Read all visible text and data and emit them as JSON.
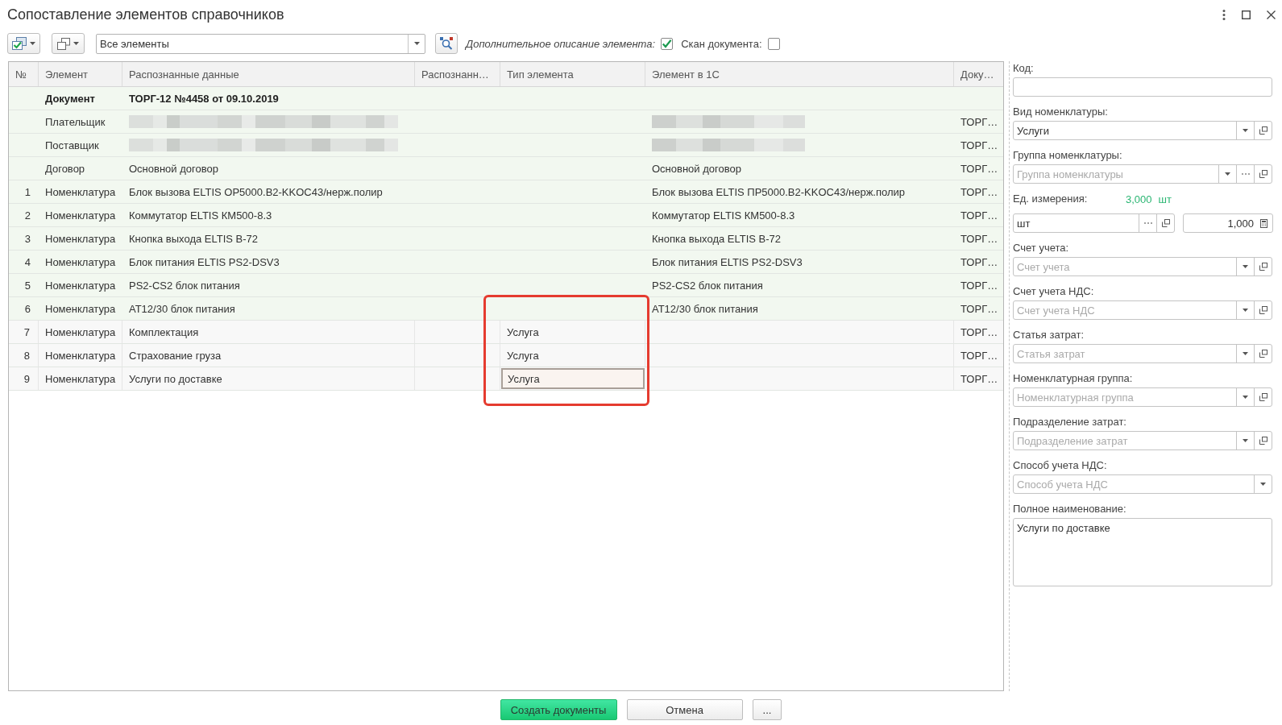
{
  "window": {
    "title": "Сопоставление элементов справочников"
  },
  "toolbar": {
    "filter": {
      "value": "Все элементы"
    },
    "options": [
      {
        "label": "Дополнительное описание элемента:",
        "italic": true,
        "checked": true
      },
      {
        "label": "Скан документа:",
        "italic": false,
        "checked": false
      }
    ]
  },
  "table": {
    "columns": [
      "№",
      "Элемент",
      "Распознанные данные",
      "Распознанн…",
      "Тип элемента",
      "Элемент в 1С",
      "Доку…"
    ],
    "rows": [
      {
        "kind": "document",
        "element": "Документ",
        "recognized": "ТОРГ-12 №4458 от 09.10.2019",
        "redacted": false,
        "matched": true,
        "selected": false
      },
      {
        "kind": "entry",
        "element": "Плательщик",
        "redacted": true,
        "doc": "ТОРГ…",
        "matched": true,
        "selected": false
      },
      {
        "kind": "entry",
        "element": "Поставщик",
        "redacted": true,
        "doc": "ТОРГ…",
        "matched": true,
        "selected": false
      },
      {
        "kind": "entry",
        "element": "Договор",
        "recognized": "Основной договор",
        "element_1c": "Основной договор",
        "doc": "ТОРГ…",
        "redacted": false,
        "matched": true,
        "selected": false
      },
      {
        "kind": "entry",
        "number": "1",
        "element": "Номенклатура",
        "recognized": "Блок вызова ELTIS OP5000.B2-KKOC43/нерж.полир",
        "element_1c": "Блок вызова ELTIS ПР5000.B2-KKOC43/нерж.полир",
        "doc": "ТОРГ…",
        "redacted": false,
        "matched": true,
        "selected": false
      },
      {
        "kind": "entry",
        "number": "2",
        "element": "Номенклатура",
        "recognized": "Коммутатор ELTIS КМ500-8.3",
        "element_1c": "Коммутатор ELTIS КМ500-8.3",
        "doc": "ТОРГ…",
        "redacted": false,
        "matched": true,
        "selected": false
      },
      {
        "kind": "entry",
        "number": "3",
        "element": "Номенклатура",
        "recognized": "Кнопка выхода ELTIS B-72",
        "element_1c": "Кнопка выхода ELTIS B-72",
        "doc": "ТОРГ…",
        "redacted": false,
        "matched": true,
        "selected": false
      },
      {
        "kind": "entry",
        "number": "4",
        "element": "Номенклатура",
        "recognized": "Блок питания ELTIS PS2-DSV3",
        "element_1c": "Блок питания ELTIS PS2-DSV3",
        "doc": "ТОРГ…",
        "redacted": false,
        "matched": true,
        "selected": false
      },
      {
        "kind": "entry",
        "number": "5",
        "element": "Номенклатура",
        "recognized": "PS2-CS2 блок питания",
        "element_1c": "PS2-CS2 блок питания",
        "doc": "ТОРГ…",
        "redacted": false,
        "matched": true,
        "selected": false
      },
      {
        "kind": "entry",
        "number": "6",
        "element": "Номенклатура",
        "recognized": "АТ12/30 блок питания",
        "element_1c": "АТ12/30 блок питания",
        "doc": "ТОРГ…",
        "redacted": false,
        "matched": true,
        "selected": false
      },
      {
        "kind": "entry",
        "number": "7",
        "element": "Номенклатура",
        "recognized": "Комплектация",
        "type": "Услуга",
        "doc": "ТОРГ…",
        "redacted": false,
        "matched": false,
        "selected": false
      },
      {
        "kind": "entry",
        "number": "8",
        "element": "Номенклатура",
        "recognized": "Страхование груза",
        "type": "Услуга",
        "doc": "ТОРГ…",
        "redacted": false,
        "matched": false,
        "selected": false
      },
      {
        "kind": "entry",
        "number": "9",
        "element": "Номенклатура",
        "recognized": "Услуги по доставке",
        "type": "Услуга",
        "doc": "ТОРГ…",
        "redacted": false,
        "matched": false,
        "selected": true
      }
    ],
    "annotation": {
      "kind": "frame"
    }
  },
  "details": {
    "fields": [
      {
        "kind": "field",
        "label": "Код:"
      },
      {
        "kind": "field",
        "label": "Вид номенклатуры:",
        "value": "Услуги",
        "buttons": [
          {
            "kind": "dropdown"
          },
          {
            "kind": "open"
          }
        ]
      },
      {
        "kind": "field",
        "label": "Группа номенклатуры:",
        "placeholder": "Группа номенклатуры",
        "buttons": [
          {
            "kind": "dropdown"
          },
          {
            "kind": "choose"
          },
          {
            "kind": "open"
          }
        ]
      },
      {
        "kind": "unit",
        "label": "Ед. измерения:",
        "total": "3,000",
        "total_unit": "шт",
        "unit": {
          "value": "шт",
          "buttons": [
            {
              "kind": "choose"
            },
            {
              "kind": "open"
            }
          ]
        },
        "quantity": {
          "value": "1,000",
          "buttons": [
            {
              "kind": "calculator"
            }
          ]
        }
      },
      {
        "kind": "field",
        "label": "Счет учета:",
        "placeholder": "Счет учета",
        "buttons": [
          {
            "kind": "dropdown"
          },
          {
            "kind": "open"
          }
        ]
      },
      {
        "kind": "field",
        "label": "Счет учета НДС:",
        "placeholder": "Счет учета НДС",
        "buttons": [
          {
            "kind": "dropdown"
          },
          {
            "kind": "open"
          }
        ]
      },
      {
        "kind": "field",
        "label": "Статья затрат:",
        "placeholder": "Статья затрат",
        "buttons": [
          {
            "kind": "dropdown"
          },
          {
            "kind": "open"
          }
        ]
      },
      {
        "kind": "field",
        "label": "Номенклатурная группа:",
        "placeholder": "Номенклатурная группа",
        "buttons": [
          {
            "kind": "dropdown"
          },
          {
            "kind": "open"
          }
        ]
      },
      {
        "kind": "field",
        "label": "Подразделение затрат:",
        "placeholder": "Подразделение затрат",
        "buttons": [
          {
            "kind": "dropdown"
          },
          {
            "kind": "open"
          }
        ]
      },
      {
        "kind": "field",
        "label": "Способ учета НДС:",
        "placeholder": "Способ учета НДС",
        "buttons": [
          {
            "kind": "dropdown"
          }
        ]
      },
      {
        "kind": "memo",
        "label": "Полное наименование:",
        "value": "Услуги по доставке"
      }
    ]
  },
  "buttons": [
    {
      "label": "Создать документы",
      "kind": "primary"
    },
    {
      "label": "Отмена",
      "kind": "default"
    },
    {
      "label": "...",
      "kind": "default"
    }
  ]
}
